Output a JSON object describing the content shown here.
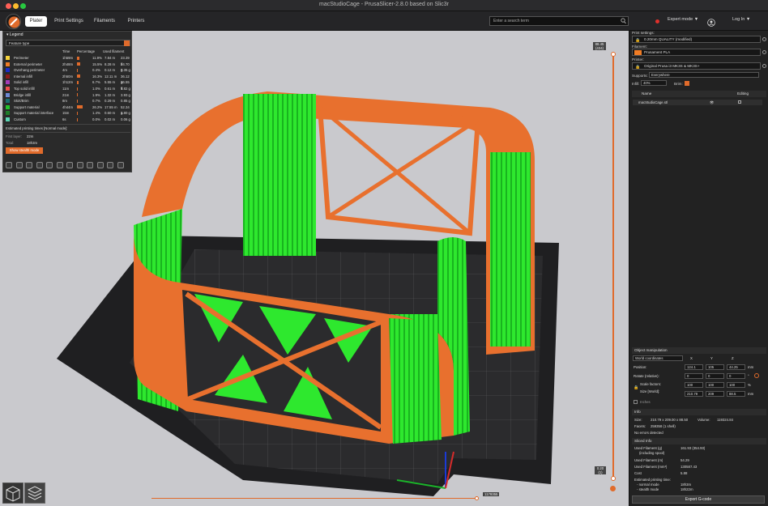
{
  "window": {
    "title": "macStudioCage - PrusaSlicer-2.8.0 based on Slic3r"
  },
  "toolbar": {
    "tabs": [
      "Plater",
      "Print Settings",
      "Filaments",
      "Printers"
    ],
    "search_placeholder": "Enter a search term",
    "mode_label": "Expert mode ▼",
    "login_label": "Log In ▼"
  },
  "legend": {
    "title": "Legend",
    "feature_type": "Feature type",
    "col_time": "Time",
    "col_percentage": "Percentage",
    "col_used_filament": "Used filament",
    "rows": [
      {
        "name": "Perimeter",
        "time": "1h59m",
        "pct": "11.9%",
        "len": "7.84 m",
        "g": "23.39 g",
        "color": "#f5d33b",
        "frac": 0.119
      },
      {
        "name": "External perimeter",
        "time": "2h48m",
        "pct": "15.5%",
        "len": "8.28 m",
        "g": "24.70 g",
        "color": "#f07c25",
        "frac": 0.155
      },
      {
        "name": "Overhang perimeter",
        "time": "4m",
        "pct": "0.4%",
        "len": "0.12 m",
        "g": "0.35 g",
        "color": "#1b2cc8",
        "frac": 0.004
      },
      {
        "name": "Internal infill",
        "time": "2h50m",
        "pct": "16.3%",
        "len": "12.11 m",
        "g": "36.12 g",
        "color": "#8e1a1a",
        "frac": 0.163
      },
      {
        "name": "Solid infill",
        "time": "1h12m",
        "pct": "6.7%",
        "len": "5.55 m",
        "g": "16.55 g",
        "color": "#a43ab8",
        "frac": 0.067
      },
      {
        "name": "Top solid infill",
        "time": "11m",
        "pct": "1.0%",
        "len": "0.61 m",
        "g": "1.82 g",
        "color": "#ef4d4d",
        "frac": 0.01
      },
      {
        "name": "Bridge infill",
        "time": "21m",
        "pct": "1.9%",
        "len": "1.32 m",
        "g": "3.93 g",
        "color": "#6e8ad6",
        "frac": 0.019
      },
      {
        "name": "Skirt/Brim",
        "time": "8m",
        "pct": "0.7%",
        "len": "0.29 m",
        "g": "0.85 g",
        "color": "#1b6e6e",
        "frac": 0.007
      },
      {
        "name": "Support material",
        "time": "4h44m",
        "pct": "26.2%",
        "len": "17.55 m",
        "g": "52.34 g",
        "color": "#22c42a",
        "frac": 0.262
      },
      {
        "name": "Support material interface",
        "time": "15m",
        "pct": "1.4%",
        "len": "0.60 m",
        "g": "1.80 g",
        "color": "#1e7d2a",
        "frac": 0.014
      },
      {
        "name": "Custom",
        "time": "6s",
        "pct": "0.0%",
        "len": "0.02 m",
        "g": "0.06 g",
        "color": "#5bd6b4",
        "frac": 0.0
      }
    ],
    "estimated_label": "Estimated printing times [Normal mode]:",
    "first_layer_label": "First layer:",
    "first_layer_value": "22m",
    "total_label": "Total:",
    "total_value": "18h3m",
    "stealth_button": "Show stealth mode"
  },
  "vslider": {
    "top_value": "88.45",
    "top_layer": "(434)",
    "bottom_value": "0.20",
    "bottom_layer": "(1)"
  },
  "hslider": {
    "value": "1179355"
  },
  "right_panel": {
    "print_settings_label": "Print settings:",
    "print_settings_value": "0.20mm QUALITY (modified)",
    "filament_label": "Filament:",
    "filament_value": "Prusament PLA",
    "filament_color": "#f07c25",
    "printer_label": "Printer:",
    "printer_value": "Original Prusa i3 MK3S & MK3S+",
    "supports_label": "Supports:",
    "supports_value": "Everywhere",
    "infill_label": "Infill:",
    "infill_value": "40%",
    "brim_label": "Brim:",
    "col_name": "Name",
    "col_editing": "Editing",
    "object_name": "macStudioCage.stl",
    "object_manipulation": "Object manipulation",
    "coords_value": "World coordinates",
    "axis_x": "X",
    "axis_y": "Y",
    "axis_z": "Z",
    "position_label": "Position:",
    "position": [
      "124.1",
      "105",
      "44.25"
    ],
    "rotate_label": "Rotate (relative):",
    "rotate": [
      "0",
      "0",
      "0"
    ],
    "scale_label": "Scale factors:",
    "scale": [
      "100",
      "100",
      "100"
    ],
    "size_label": "Size [World]:",
    "size": [
      "210.79",
      "209",
      "88.5"
    ],
    "unit_mm": "mm",
    "unit_deg": "°",
    "unit_pct": "%",
    "inches_label": "Inches",
    "info_label": "Info",
    "info_size_label": "Size:",
    "info_size": "210.79 x 209.00 x 88.50",
    "info_volume_label": "Volume:",
    "info_volume": "119324.84",
    "info_facets_label": "Facets:",
    "info_facets": "259358 (1 shell)",
    "info_errors": "No errors detected",
    "sliced_info_label": "Sliced Info",
    "used_filament_g_label": "Used Filament (g)",
    "used_filament_g_sub": "(including spool)",
    "used_filament_g": "161.93 (354.93)",
    "used_filament_m_label": "Used Filament (m)",
    "used_filament_m": "54.29",
    "used_filament_mm3_label": "Used Filament (mm³)",
    "used_filament_mm3": "130587.43",
    "cost_label": "Cost",
    "cost": "5.88",
    "est_label": "Estimated printing time:",
    "normal_mode_label": "- normal mode",
    "normal_mode": "18h3m",
    "stealth_mode_label": "- stealth mode",
    "stealth_mode": "18h22m",
    "export_button": "Export G-code"
  },
  "colors": {
    "accent": "#e06b2b",
    "support": "#22c42a",
    "perimeter": "#e8702e"
  }
}
